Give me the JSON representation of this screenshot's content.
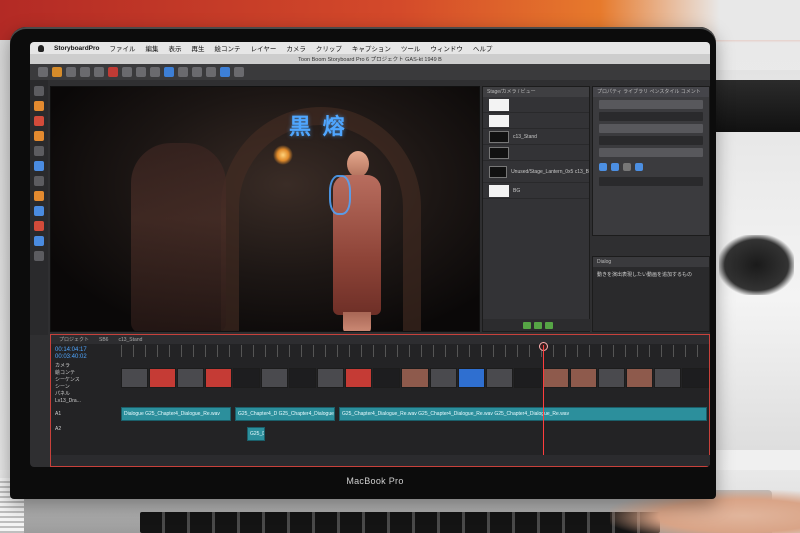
{
  "device": {
    "brand": "MacBook Pro"
  },
  "menubar": {
    "app_name": "StoryboardPro",
    "items": [
      "ファイル",
      "編集",
      "表示",
      "再生",
      "絵コンテ",
      "レイヤー",
      "カメラ",
      "クリップ",
      "キャプション",
      "ツール",
      "ウィンドウ",
      "ヘルプ"
    ]
  },
  "window": {
    "title": "Toon Boom Storyboard Pro 6 プロジェクト GAS-kt 1949 B"
  },
  "viewport": {
    "sketch_text": "黒 熔"
  },
  "layers_panel": {
    "header": "Stage/カメラ / ビュー",
    "rows": [
      "",
      "",
      "c13_Stand",
      "",
      "Unused/Stage_Lantern_0x5 c13_BG03",
      "BG"
    ]
  },
  "props_panel": {
    "tabs": "プロパティ  ライブラリ  ペンスタイル  コメント"
  },
  "notes_panel": {
    "header": "Dialog",
    "text": "動きを演出表現したい動画を追加するもの"
  },
  "timeline": {
    "header_items": [
      "プロジェクト",
      "SB6",
      "c13_Stand"
    ],
    "timecode": "00:14:04:17",
    "timecode2": "00:03:40:02",
    "track_labels": [
      "カメラ",
      "絵コンテ",
      "シーケンス",
      "シーン",
      "パネル",
      "Lv13_Dra...",
      "A1",
      "A2"
    ],
    "audio_clips": [
      "Dialogue G25_Chapter4_Dialogue_Re.wav",
      "G25_Chapter4_D G25_Chapter4_Dialogue_Re.wav",
      "G25_Chapter4_Dialogue_Re.wav G25_Chapter4_Dialogue_Re.wav G25_Chapter4_Dialogue_Re.wav",
      "G25_D"
    ]
  }
}
